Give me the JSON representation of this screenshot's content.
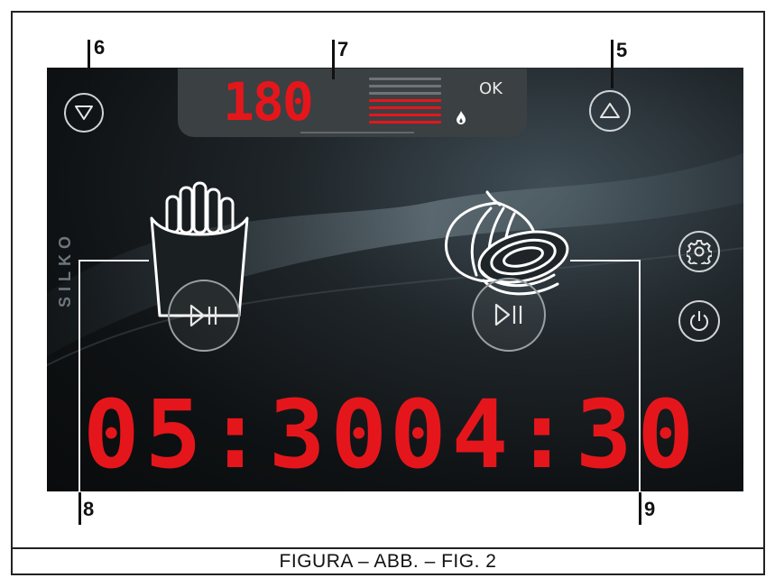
{
  "figure": {
    "caption": "FIGURA – ABB. – FIG. 2"
  },
  "brand": {
    "name": "SILKO"
  },
  "temperature_panel": {
    "value": "180",
    "status": "OK",
    "level_total": 7,
    "level_active": 4,
    "colors": {
      "active": "#e5161b",
      "inactive": "#6e7478",
      "digits": "#e5161b"
    }
  },
  "buttons": {
    "temp_down": {
      "icon": "triangle-down-icon"
    },
    "temp_up": {
      "icon": "triangle-up-icon"
    },
    "settings": {
      "icon": "gear-icon"
    },
    "power": {
      "icon": "power-icon"
    }
  },
  "programs": [
    {
      "name": "fries",
      "icon": "fries-icon",
      "play_icon": "play-pause-icon",
      "timer": "05:30"
    },
    {
      "name": "onion",
      "icon": "onion-icon",
      "play_icon": "play-pause-icon",
      "timer": "04:30"
    }
  ],
  "callouts": [
    "6",
    "7",
    "5",
    "8",
    "9"
  ]
}
